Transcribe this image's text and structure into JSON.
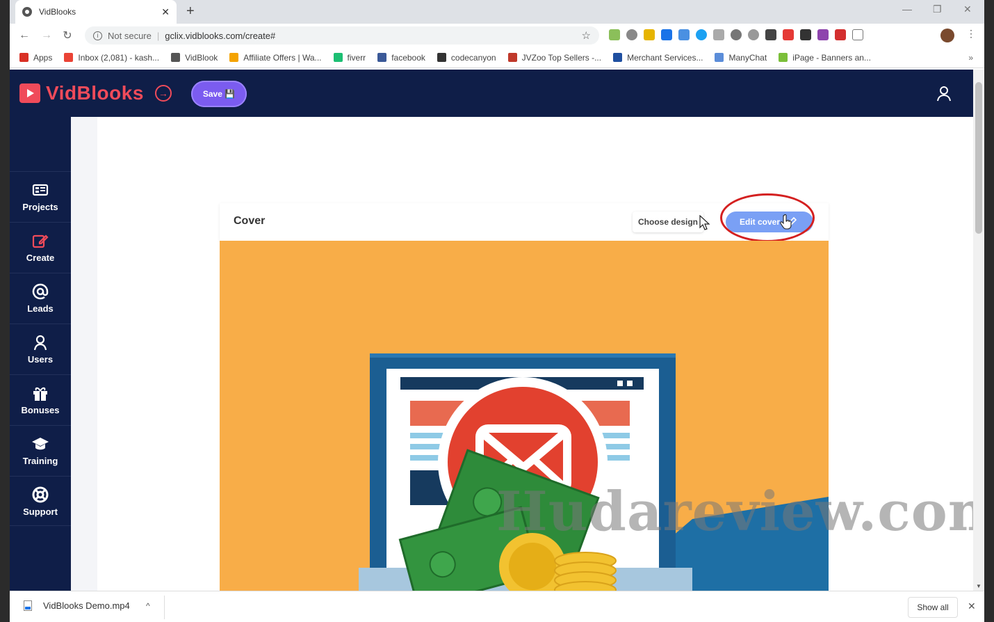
{
  "browser": {
    "tab_title": "VidBlooks",
    "tab_close": "✕",
    "new_tab": "+",
    "window_controls": {
      "minimize": "—",
      "restore": "❐",
      "close": "✕"
    },
    "nav": {
      "back": "←",
      "forward": "→",
      "reload": "↻"
    },
    "address": {
      "security": "Not secure",
      "url": "gclix.vidblooks.com/create#"
    },
    "bookmarks": [
      {
        "label": "Apps",
        "color": "#d93025"
      },
      {
        "label": "Inbox (2,081) - kash...",
        "color": "#ea4335"
      },
      {
        "label": "VidBlook",
        "color": "#555555"
      },
      {
        "label": "Affiliate Offers | Wa...",
        "color": "#f4a300"
      },
      {
        "label": "fiverr",
        "color": "#1dbf73"
      },
      {
        "label": "facebook",
        "color": "#3b5998"
      },
      {
        "label": "codecanyon",
        "color": "#333333"
      },
      {
        "label": "JVZoo Top Sellers -...",
        "color": "#c0392b"
      },
      {
        "label": "Merchant Services...",
        "color": "#1f4fa0"
      },
      {
        "label": "ManyChat",
        "color": "#5b8dd9"
      },
      {
        "label": "iPage - Banners an...",
        "color": "#7bbf3a"
      }
    ],
    "bookmarks_more": "»",
    "menu": "⋮"
  },
  "app": {
    "logo_text": "VidBlooks",
    "logo_arrow": "→",
    "save_label": "Save 💾",
    "sidebar": [
      {
        "label": "Projects",
        "icon": "projects-icon"
      },
      {
        "label": "Create",
        "icon": "edit-icon"
      },
      {
        "label": "Leads",
        "icon": "at-icon"
      },
      {
        "label": "Users",
        "icon": "user-icon"
      },
      {
        "label": "Bonuses",
        "icon": "gift-icon"
      },
      {
        "label": "Training",
        "icon": "graduation-cap-icon"
      },
      {
        "label": "Support",
        "icon": "lifebuoy-icon"
      }
    ],
    "card": {
      "title": "Cover",
      "choose_design": "Choose design",
      "edit_cover": "Edit cover"
    },
    "accent": "#f04b5a",
    "nav_bg": "#0f1e48"
  },
  "watermark": "Hudareview.com",
  "downloads": {
    "file_name": "VidBlooks Demo.mp4",
    "chevron": "^",
    "show_all": "Show all",
    "close": "✕"
  }
}
